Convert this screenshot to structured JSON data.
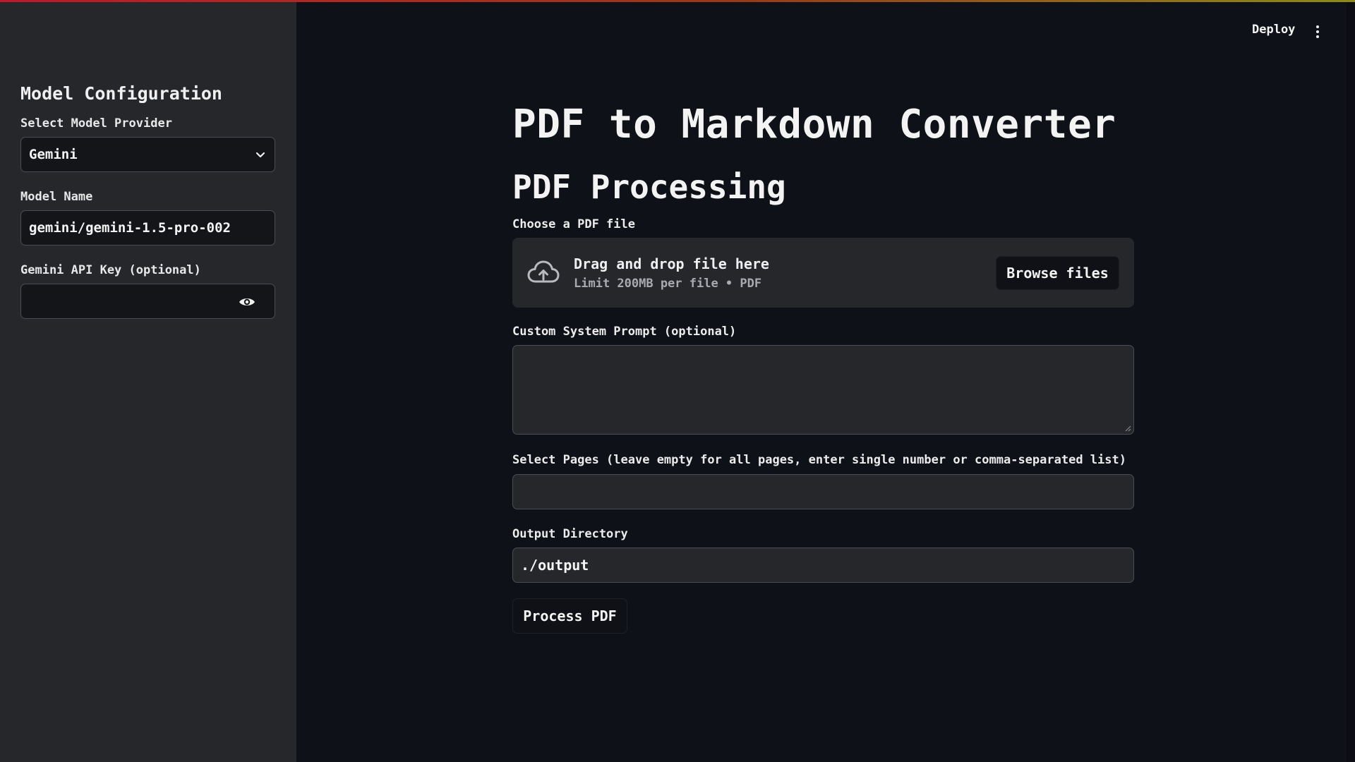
{
  "header": {
    "deploy_label": "Deploy"
  },
  "sidebar": {
    "title": "Model Configuration",
    "provider_label": "Select Model Provider",
    "provider_value": "Gemini",
    "model_name_label": "Model Name",
    "model_name_value": "gemini/gemini-1.5-pro-002",
    "api_key_label": "Gemini API Key (optional)",
    "api_key_value": ""
  },
  "main": {
    "title": "PDF to Markdown Converter",
    "section_title": "PDF Processing",
    "file_label": "Choose a PDF file",
    "drop_text": "Drag and drop file here",
    "limit_text": "Limit 200MB per file • PDF",
    "browse_label": "Browse files",
    "prompt_label": "Custom System Prompt (optional)",
    "prompt_value": "",
    "pages_label": "Select Pages (leave empty for all pages, enter single number or comma-separated list)",
    "pages_value": "",
    "output_label": "Output Directory",
    "output_value": "./output",
    "process_label": "Process PDF"
  },
  "icons": {
    "dropdown": "chevron-down-icon",
    "password_toggle": "eye-icon",
    "upload": "cloud-upload-icon",
    "menu": "kebab-menu-icon"
  },
  "colors": {
    "background": "#0e1117",
    "sidebar": "#25272b",
    "accent_gradient_start": "#c0182a",
    "accent_gradient_end": "#8d8a17"
  }
}
